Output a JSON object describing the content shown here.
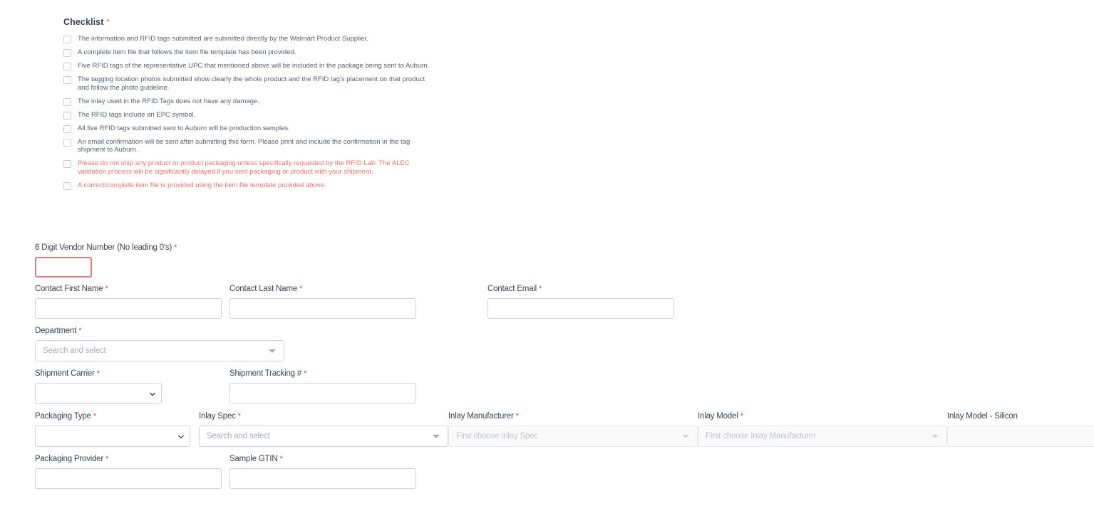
{
  "checklist": {
    "title": "Checklist",
    "required_marker": "*",
    "items": [
      {
        "text": "The information and RFID tags submitted are submitted directly by the Walmart Product Supplier.",
        "checked": false,
        "warning": false
      },
      {
        "text": "A complete item file that follows the item file template has been provided.",
        "checked": false,
        "warning": false
      },
      {
        "text": "Five RFID tags of the representative UPC that mentioned above will be included in the package being sent to Auburn.",
        "checked": false,
        "warning": false
      },
      {
        "text": "The tagging location photos submitted show clearly the whole product and the RFID tag's placement on that product and follow the photo guideline.",
        "checked": false,
        "warning": false
      },
      {
        "text": "The inlay used in the RFID Tags does not have any damage.",
        "checked": false,
        "warning": false
      },
      {
        "text": "The RFID tags include an EPC symbol.",
        "checked": false,
        "warning": false
      },
      {
        "text": "All five RFID tags submitted sent to Auburn will be production samples.",
        "checked": false,
        "warning": false
      },
      {
        "text": "An email confirmation will be sent after submitting this form. Please print and include the confirmation in the tag shipment to Auburn.",
        "checked": false,
        "warning": false
      },
      {
        "text": "Please do not ship any product or product packaging unless specifically requested by the RFID Lab. The ALEC validation process will be significantly delayed if you sent packaging or product with your shipment.",
        "checked": false,
        "warning": true
      },
      {
        "text": "A correct/complete item file is provided using the item file template provided above.",
        "checked": false,
        "warning": true
      }
    ]
  },
  "form": {
    "vendor_number": {
      "label": "6 Digit Vendor Number (No leading 0's)",
      "required": "*",
      "value": "",
      "placeholder": "",
      "error": true
    },
    "contact_first_name": {
      "label": "Contact First Name",
      "required": "*",
      "value": "",
      "placeholder": ""
    },
    "contact_last_name": {
      "label": "Contact Last Name",
      "required": "*",
      "value": "",
      "placeholder": ""
    },
    "contact_email": {
      "label": "Contact Email",
      "required": "*",
      "value": "",
      "placeholder": ""
    },
    "department": {
      "label": "Department",
      "required": "*",
      "placeholder": "Search and select",
      "selected": "",
      "disabled": false
    },
    "shipment_carrier": {
      "label": "Shipment Carrier",
      "required": "*",
      "selected": "",
      "options": [
        ""
      ]
    },
    "shipment_tracking": {
      "label": "Shipment Tracking #",
      "required": "*",
      "value": "",
      "placeholder": ""
    },
    "packaging_type": {
      "label": "Packaging Type",
      "required": "*",
      "selected": "",
      "options": [
        ""
      ]
    },
    "inlay_spec": {
      "label": "Inlay Spec",
      "required": "*",
      "placeholder": "Search and select",
      "selected": "",
      "disabled": false
    },
    "inlay_manufacturer": {
      "label": "Inlay Manufacturer",
      "required": "*",
      "placeholder": "First choose Inlay Spec",
      "selected": "",
      "disabled": true
    },
    "inlay_model": {
      "label": "Inlay Model",
      "required": "*",
      "placeholder": "First choose Inlay Manufacturer",
      "selected": "",
      "disabled": true
    },
    "inlay_model_silicon": {
      "label": "Inlay Model - Silicon",
      "required": "",
      "placeholder": "",
      "selected": "",
      "disabled": true
    },
    "packaging_provider": {
      "label": "Packaging Provider",
      "required": "*",
      "value": "",
      "placeholder": ""
    },
    "sample_gtin": {
      "label": "Sample GTIN",
      "required": "*",
      "value": "",
      "placeholder": ""
    }
  },
  "colors": {
    "required_star": "#f23b3b",
    "checklist_star": "#e8736b",
    "warning_text": "#e8736b",
    "error_border": "#e07b7b",
    "label_text": "#3b4250",
    "field_border": "#cfd2d7",
    "placeholder": "#a8adb6"
  }
}
